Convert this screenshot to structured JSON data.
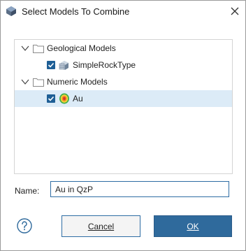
{
  "window": {
    "title": "Select Models To Combine"
  },
  "tree": {
    "groups": [
      {
        "label": "Geological Models",
        "expanded": true,
        "items": [
          {
            "label": "SimpleRockType",
            "checked": true,
            "icon": "geological-model-icon"
          }
        ]
      },
      {
        "label": "Numeric Models",
        "expanded": true,
        "items": [
          {
            "label": "Au",
            "checked": true,
            "icon": "numeric-model-icon",
            "selected": true
          }
        ]
      }
    ]
  },
  "form": {
    "name_label": "Name:",
    "name_value": "Au in QzP"
  },
  "buttons": {
    "cancel": "Cancel",
    "ok": "OK"
  },
  "colors": {
    "accent": "#2f6a9c",
    "selected_row": "#dcebf7",
    "checkbox": "#1f5f96"
  }
}
